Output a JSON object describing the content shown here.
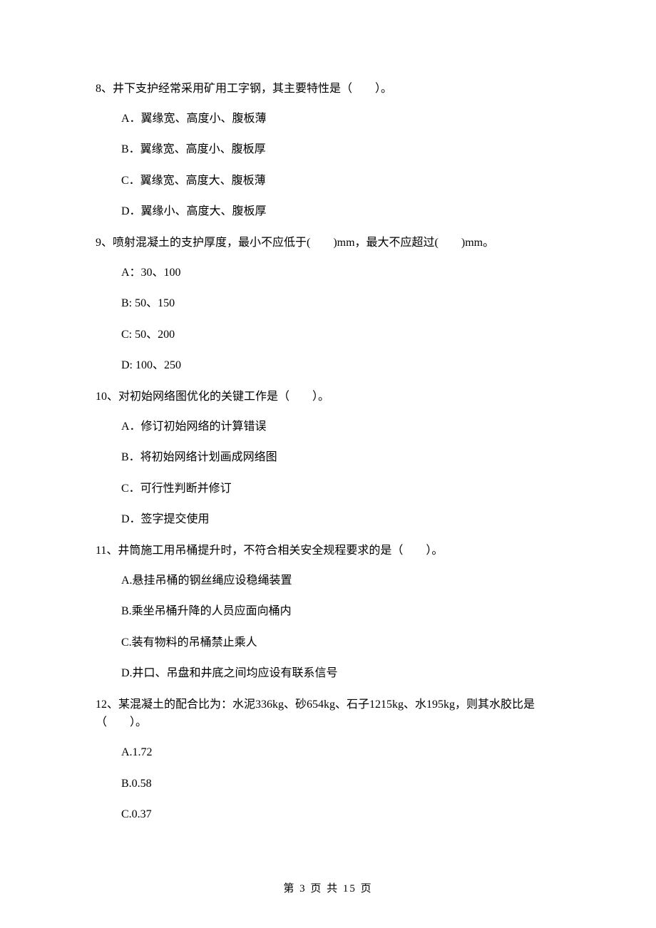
{
  "questions": [
    {
      "stem": "8、井下支护经常采用矿用工字钢，其主要特性是（　　）。",
      "options": [
        "A．翼缘宽、高度小、腹板薄",
        "B．翼缘宽、高度小、腹板厚",
        "C．翼缘宽、高度大、腹板薄",
        "D．翼缘小、高度大、腹板厚"
      ]
    },
    {
      "stem": "9、喷射混凝土的支护厚度，最小不应低于(　　)mm，最大不应超过(　　)mm。",
      "options": [
        "A：30、100",
        "B: 50、150",
        "C: 50、200",
        "D: 100、250"
      ]
    },
    {
      "stem": "10、对初始网络图优化的关键工作是（　　）。",
      "options": [
        "A．修订初始网络的计算错误",
        "B．将初始网络计划画成网络图",
        "C．可行性判断并修订",
        "D．签字提交使用"
      ]
    },
    {
      "stem": "11、井筒施工用吊桶提升时，不符合相关安全规程要求的是（　　）。",
      "options": [
        "A.悬挂吊桶的钢丝绳应设稳绳装置",
        "B.乘坐吊桶升降的人员应面向桶内",
        "C.装有物料的吊桶禁止乘人",
        "D.井口、吊盘和井底之间均应设有联系信号"
      ]
    },
    {
      "stem": "12、某混凝土的配合比为：水泥336kg、砂654kg、石子1215kg、水195kg，则其水胶比是（　　）。",
      "options": [
        "A.1.72",
        "B.0.58",
        "C.0.37"
      ]
    }
  ],
  "footer": "第 3 页 共 15 页"
}
